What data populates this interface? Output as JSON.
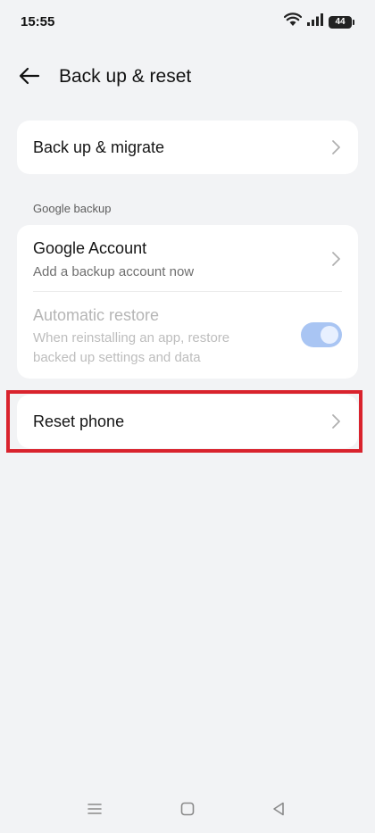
{
  "status_bar": {
    "time": "15:55",
    "battery_level": "44",
    "icons": [
      "wifi-icon",
      "signal-icon",
      "battery-icon"
    ]
  },
  "app_bar": {
    "title": "Back up & reset",
    "back_icon": "arrow-left-icon"
  },
  "items": {
    "backup_migrate": {
      "title": "Back up & migrate"
    },
    "section_google": "Google backup",
    "google_account": {
      "title": "Google Account",
      "subtitle": "Add a backup account now"
    },
    "automatic_restore": {
      "title": "Automatic restore",
      "subtitle_line1": "When reinstalling an app, restore",
      "subtitle_line2": "backed up settings and data",
      "enabled": false,
      "toggle_on": true
    },
    "reset_phone": {
      "title": "Reset phone"
    }
  },
  "highlight_color": "#d9232d",
  "nav_bar": {
    "buttons": [
      "menu-icon",
      "home-icon",
      "back-triangle-icon"
    ]
  },
  "colors": {
    "background": "#f2f3f5",
    "card": "#ffffff",
    "toggle_track": "#a9c5f3"
  }
}
